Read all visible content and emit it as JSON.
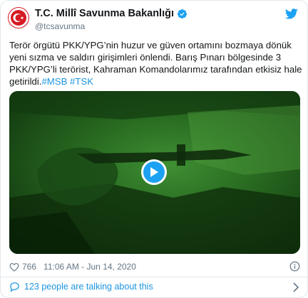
{
  "account": {
    "name": "T.C. Millî Savunma Bakanlığı",
    "handle": "@tcsavunma",
    "logo": "crescent-star-seal-icon"
  },
  "tweet": {
    "text": "Terör örgütü PKK/YPG’nin huzur ve güven ortamını bozmaya dönük yeni sızma ve saldırı girişimleri önlendi.  Barış Pınarı bölgesinde 3 PKK/YPG’li terörist, Kahraman Komandolarımız tarafından etkisiz hale getirildi.",
    "hashtags": [
      "#MSB",
      "#TSK"
    ]
  },
  "media": {
    "type": "video",
    "play_icon": "play-icon"
  },
  "meta": {
    "likes": "766",
    "timestamp": "11:06 AM - Jun 14, 2020"
  },
  "footer": {
    "talking": "123 people are talking about this"
  },
  "colors": {
    "accent": "#1da1f2",
    "link": "#1b95e0",
    "brand_red": "#d61a24",
    "text_secondary": "#657786"
  }
}
